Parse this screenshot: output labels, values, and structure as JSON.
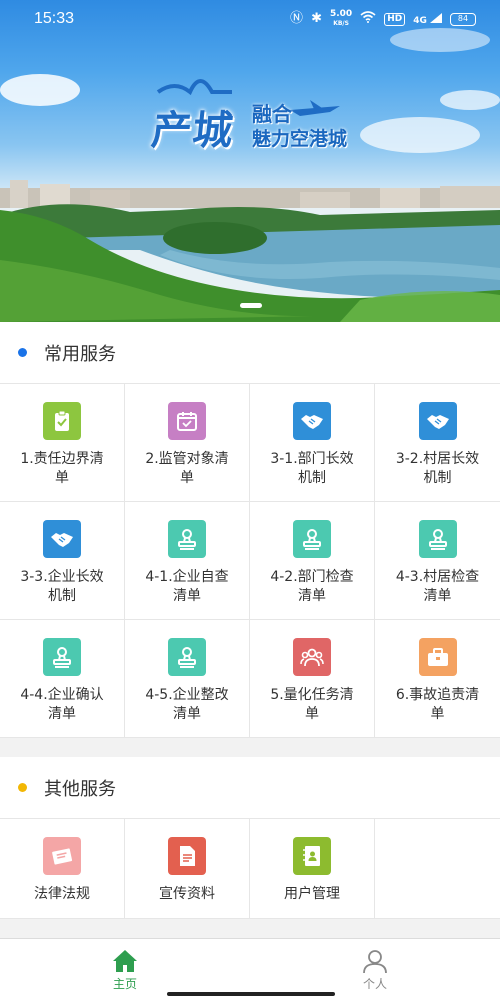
{
  "status_bar": {
    "time": "15:33",
    "speed_value": "5.00",
    "speed_unit": "KB/S",
    "hd": "HD",
    "network": "4G",
    "battery": "84"
  },
  "banner": {
    "title_main": "产城",
    "title_line1": "融合",
    "title_line2": "魅力空港城"
  },
  "common_services": {
    "title": "常用服务",
    "dot_color": "#1a73e8",
    "items": [
      {
        "label": "1.责任边界清单",
        "icon": "clipboard-check-icon",
        "color": "#8dc63f"
      },
      {
        "label": "2.监管对象清单",
        "icon": "calendar-icon",
        "color": "#c67fc4"
      },
      {
        "label": "3-1.部门长效机制",
        "icon": "handshake-icon",
        "color": "#2f8fd8"
      },
      {
        "label": "3-2.村居长效机制",
        "icon": "handshake-icon",
        "color": "#2f8fd8"
      },
      {
        "label": "3-3.企业长效机制",
        "icon": "handshake-icon",
        "color": "#2f8fd8"
      },
      {
        "label": "4-1.企业自查清单",
        "icon": "stamp-icon",
        "color": "#4cc9b0"
      },
      {
        "label": "4-2.部门检查清单",
        "icon": "stamp-icon",
        "color": "#4cc9b0"
      },
      {
        "label": "4-3.村居检查清单",
        "icon": "stamp-icon",
        "color": "#4cc9b0"
      },
      {
        "label": "4-4.企业确认清单",
        "icon": "stamp-icon",
        "color": "#4cc9b0"
      },
      {
        "label": "4-5.企业整改清单",
        "icon": "stamp-icon",
        "color": "#4cc9b0"
      },
      {
        "label": "5.量化任务清单",
        "icon": "group-icon",
        "color": "#e06666"
      },
      {
        "label": "6.事故追责清单",
        "icon": "toolbox-icon",
        "color": "#f4a261"
      }
    ]
  },
  "other_services": {
    "title": "其他服务",
    "dot_color": "#f2b705",
    "items": [
      {
        "label": "法律法规",
        "icon": "law-book-icon",
        "color": "#f4a6a6"
      },
      {
        "label": "宣传资料",
        "icon": "document-icon",
        "color": "#e3604f"
      },
      {
        "label": "用户管理",
        "icon": "contact-book-icon",
        "color": "#8dbb2f"
      }
    ]
  },
  "bottom_nav": {
    "active_color": "#2e9e4f",
    "items": [
      {
        "label": "主页",
        "icon": "home-icon",
        "active": true
      },
      {
        "label": "个人",
        "icon": "person-icon",
        "active": false
      }
    ]
  }
}
